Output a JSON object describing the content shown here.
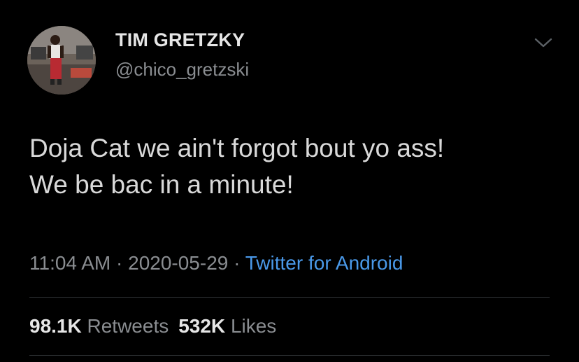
{
  "author": {
    "name": "TIM GRETZKY",
    "handle": "@chico_gretzski"
  },
  "tweet": {
    "text": "Doja Cat we ain't forgot bout yo ass!\nWe be bac in a minute!"
  },
  "meta": {
    "time": "11:04 AM",
    "separator": "·",
    "date": "2020-05-29",
    "source": "Twitter for Android"
  },
  "stats": {
    "retweets_count": "98.1K",
    "retweets_label": "Retweets",
    "likes_count": "532K",
    "likes_label": "Likes"
  },
  "icons": {
    "menu": "chevron-down-icon"
  },
  "colors": {
    "background": "#000000",
    "text": "#d9d9d9",
    "secondary": "#8a8d91",
    "link": "#4a99e9",
    "divider": "#2f3336"
  }
}
